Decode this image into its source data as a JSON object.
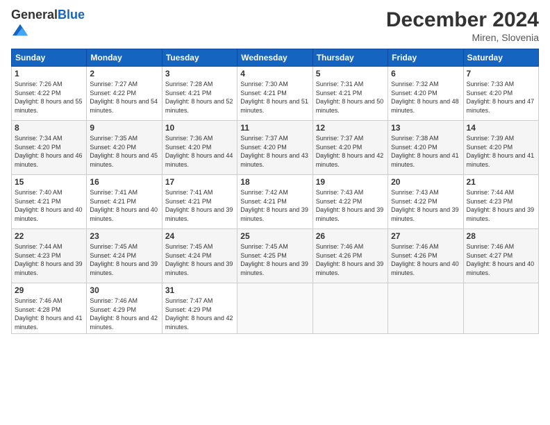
{
  "logo": {
    "general": "General",
    "blue": "Blue"
  },
  "title": "December 2024",
  "location": "Miren, Slovenia",
  "days_of_week": [
    "Sunday",
    "Monday",
    "Tuesday",
    "Wednesday",
    "Thursday",
    "Friday",
    "Saturday"
  ],
  "weeks": [
    [
      {
        "day": "1",
        "sunrise": "7:26 AM",
        "sunset": "4:22 PM",
        "daylight": "8 hours and 55 minutes."
      },
      {
        "day": "2",
        "sunrise": "7:27 AM",
        "sunset": "4:22 PM",
        "daylight": "8 hours and 54 minutes."
      },
      {
        "day": "3",
        "sunrise": "7:28 AM",
        "sunset": "4:21 PM",
        "daylight": "8 hours and 52 minutes."
      },
      {
        "day": "4",
        "sunrise": "7:30 AM",
        "sunset": "4:21 PM",
        "daylight": "8 hours and 51 minutes."
      },
      {
        "day": "5",
        "sunrise": "7:31 AM",
        "sunset": "4:21 PM",
        "daylight": "8 hours and 50 minutes."
      },
      {
        "day": "6",
        "sunrise": "7:32 AM",
        "sunset": "4:20 PM",
        "daylight": "8 hours and 48 minutes."
      },
      {
        "day": "7",
        "sunrise": "7:33 AM",
        "sunset": "4:20 PM",
        "daylight": "8 hours and 47 minutes."
      }
    ],
    [
      {
        "day": "8",
        "sunrise": "7:34 AM",
        "sunset": "4:20 PM",
        "daylight": "8 hours and 46 minutes."
      },
      {
        "day": "9",
        "sunrise": "7:35 AM",
        "sunset": "4:20 PM",
        "daylight": "8 hours and 45 minutes."
      },
      {
        "day": "10",
        "sunrise": "7:36 AM",
        "sunset": "4:20 PM",
        "daylight": "8 hours and 44 minutes."
      },
      {
        "day": "11",
        "sunrise": "7:37 AM",
        "sunset": "4:20 PM",
        "daylight": "8 hours and 43 minutes."
      },
      {
        "day": "12",
        "sunrise": "7:37 AM",
        "sunset": "4:20 PM",
        "daylight": "8 hours and 42 minutes."
      },
      {
        "day": "13",
        "sunrise": "7:38 AM",
        "sunset": "4:20 PM",
        "daylight": "8 hours and 41 minutes."
      },
      {
        "day": "14",
        "sunrise": "7:39 AM",
        "sunset": "4:20 PM",
        "daylight": "8 hours and 41 minutes."
      }
    ],
    [
      {
        "day": "15",
        "sunrise": "7:40 AM",
        "sunset": "4:21 PM",
        "daylight": "8 hours and 40 minutes."
      },
      {
        "day": "16",
        "sunrise": "7:41 AM",
        "sunset": "4:21 PM",
        "daylight": "8 hours and 40 minutes."
      },
      {
        "day": "17",
        "sunrise": "7:41 AM",
        "sunset": "4:21 PM",
        "daylight": "8 hours and 39 minutes."
      },
      {
        "day": "18",
        "sunrise": "7:42 AM",
        "sunset": "4:21 PM",
        "daylight": "8 hours and 39 minutes."
      },
      {
        "day": "19",
        "sunrise": "7:43 AM",
        "sunset": "4:22 PM",
        "daylight": "8 hours and 39 minutes."
      },
      {
        "day": "20",
        "sunrise": "7:43 AM",
        "sunset": "4:22 PM",
        "daylight": "8 hours and 39 minutes."
      },
      {
        "day": "21",
        "sunrise": "7:44 AM",
        "sunset": "4:23 PM",
        "daylight": "8 hours and 39 minutes."
      }
    ],
    [
      {
        "day": "22",
        "sunrise": "7:44 AM",
        "sunset": "4:23 PM",
        "daylight": "8 hours and 39 minutes."
      },
      {
        "day": "23",
        "sunrise": "7:45 AM",
        "sunset": "4:24 PM",
        "daylight": "8 hours and 39 minutes."
      },
      {
        "day": "24",
        "sunrise": "7:45 AM",
        "sunset": "4:24 PM",
        "daylight": "8 hours and 39 minutes."
      },
      {
        "day": "25",
        "sunrise": "7:45 AM",
        "sunset": "4:25 PM",
        "daylight": "8 hours and 39 minutes."
      },
      {
        "day": "26",
        "sunrise": "7:46 AM",
        "sunset": "4:26 PM",
        "daylight": "8 hours and 39 minutes."
      },
      {
        "day": "27",
        "sunrise": "7:46 AM",
        "sunset": "4:26 PM",
        "daylight": "8 hours and 40 minutes."
      },
      {
        "day": "28",
        "sunrise": "7:46 AM",
        "sunset": "4:27 PM",
        "daylight": "8 hours and 40 minutes."
      }
    ],
    [
      {
        "day": "29",
        "sunrise": "7:46 AM",
        "sunset": "4:28 PM",
        "daylight": "8 hours and 41 minutes."
      },
      {
        "day": "30",
        "sunrise": "7:46 AM",
        "sunset": "4:29 PM",
        "daylight": "8 hours and 42 minutes."
      },
      {
        "day": "31",
        "sunrise": "7:47 AM",
        "sunset": "4:29 PM",
        "daylight": "8 hours and 42 minutes."
      },
      null,
      null,
      null,
      null
    ]
  ],
  "labels": {
    "sunrise": "Sunrise:",
    "sunset": "Sunset:",
    "daylight": "Daylight:"
  }
}
